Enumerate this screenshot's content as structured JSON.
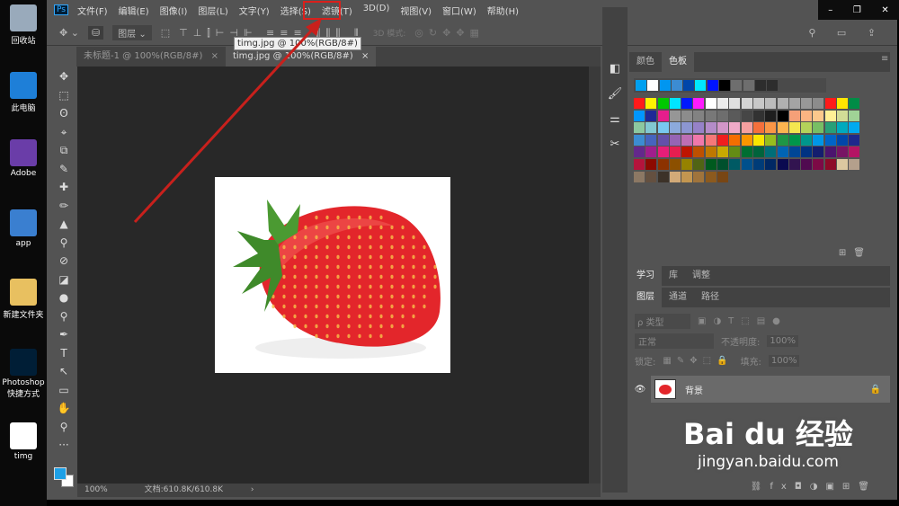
{
  "desktop": {
    "icons": [
      {
        "label": "回收站"
      },
      {
        "label": "此电脑"
      },
      {
        "label": "Adobe"
      },
      {
        "label": "app"
      },
      {
        "label": "新建文件夹"
      },
      {
        "label": "Photoshop 快捷方式"
      },
      {
        "label": "timg"
      }
    ]
  },
  "menu": {
    "logo": "Ps",
    "items": [
      "文件(F)",
      "编辑(E)",
      "图像(I)",
      "图层(L)",
      "文字(Y)",
      "选择(S)",
      "滤镜(T)",
      "3D(D)",
      "视图(V)",
      "窗口(W)",
      "帮助(H)"
    ],
    "highlighted": "滤镜(T)",
    "highlight_color": "#d9201c"
  },
  "options": {
    "auto_select": "图层",
    "mode_3d": "3D 模式:"
  },
  "tabs": [
    {
      "label": "未标题-1 @ 100%(RGB/8#)",
      "close": "×"
    },
    {
      "label": "timg.jpg @ 100%(RGB/8#)",
      "close": "×",
      "active": true
    }
  ],
  "tooltip": "timg.jpg @ 100%(RGB/8#)",
  "tools": [
    "✥",
    "⬚",
    "ʘ",
    "⌖",
    "⧉",
    "✎",
    "✚",
    "✏",
    "▲",
    "⚲",
    "⊘",
    "◪",
    "●",
    "⚲",
    "✒",
    "T",
    "↖",
    "▭",
    "✋",
    "⚲",
    "···"
  ],
  "colors": {
    "foreground": "#1ea0e6",
    "background": "#ffffff"
  },
  "status": {
    "zoom": "100%",
    "doc": "文档:610.8K/610.8K",
    "arrow": "›"
  },
  "color_panel": {
    "tabs": [
      "颜色",
      "色板"
    ],
    "active": "色板",
    "recent": [
      "#00a0f0",
      "#ffffff",
      "#0096f0",
      "#3c8cd2",
      "#0046aa",
      "#00e6ff",
      "#0014ff",
      "#000000",
      "#6e6e6e",
      "#6e6e6e",
      "#2d2d2d",
      "#2d2d2d"
    ],
    "swatches": [
      [
        "#ff1a1a",
        "#fff200",
        "#00c800",
        "#00e5ff",
        "#0018ff",
        "#ff1aff",
        "#ffffff",
        "#ececec",
        "#e0e0e0",
        "#d4d4d4",
        "#c8c8c8",
        "#bcbcbc",
        "#b0b0b0",
        "#a4a4a4",
        "#989898",
        "#8c8c8c",
        "#ff1a1a",
        "#ffe600",
        "#008c46"
      ],
      [
        "#0096ff",
        "#1e2896",
        "#e61e8c",
        "#969696",
        "#8c8c8c",
        "#828282",
        "#787878",
        "#6e6e6e",
        "#5a5a5a",
        "#464646",
        "#323232",
        "#1e1e1e",
        "#000000",
        "#f5a078",
        "#fab482",
        "#fcc88c",
        "#fff096",
        "#d2dc96",
        "#a0d296"
      ],
      [
        "#8cc8a0",
        "#82c8d2",
        "#78c8f0",
        "#8caadc",
        "#8c96d2",
        "#9682c8",
        "#b48cc8",
        "#d296c8",
        "#f0aac8",
        "#f5a0a0",
        "#f5703c",
        "#fa9646",
        "#fcb450",
        "#f5e650",
        "#b4d25a",
        "#78be64",
        "#28a078",
        "#00aabe",
        "#00aaf0"
      ],
      [
        "#3c8cd2",
        "#4664be",
        "#6450aa",
        "#9664b4",
        "#be6eb4",
        "#f078aa",
        "#f57878",
        "#f01e1e",
        "#f56e00",
        "#fa9600",
        "#fae600",
        "#96be1e",
        "#1e9646",
        "#00964b",
        "#00968c",
        "#0096e6",
        "#0064c8",
        "#0046aa",
        "#1e288c"
      ],
      [
        "#64288c",
        "#a01e8c",
        "#e61e78",
        "#e61e50",
        "#be1400",
        "#be5000",
        "#be7800",
        "#c8aa00",
        "#648c14",
        "#006e32",
        "#00643c",
        "#006e78",
        "#0064b4",
        "#004696",
        "#003282",
        "#141e6e",
        "#4b146e",
        "#781464",
        "#b41464"
      ],
      [
        "#b4143c",
        "#8c0a00",
        "#8c3200",
        "#8c5000",
        "#968200",
        "#506414",
        "#005a1e",
        "#00502d",
        "#005a64",
        "#00508c",
        "#003c78",
        "#002864",
        "#0a0a50",
        "#321450",
        "#500a50",
        "#7d0a46",
        "#8c0a28",
        "#dcc8a0",
        "#b4a08c"
      ],
      [
        "#8c7864",
        "#645040",
        "#3c3228",
        "#d2aa78",
        "#c39650",
        "#a0743c",
        "#8c5a1e",
        "#784614"
      ]
    ]
  },
  "learn_panel": {
    "tabs": [
      "学习",
      "库",
      "调整"
    ]
  },
  "layers_panel": {
    "tabs": [
      "图层",
      "通道",
      "路径"
    ],
    "filter": "ρ 类型",
    "blend": "正常",
    "opacity_label": "不透明度:",
    "opacity": "100%",
    "lock_label": "锁定:",
    "fill_label": "填充:",
    "fill": "100%",
    "layers": [
      {
        "name": "背景",
        "visible": true,
        "locked": true
      }
    ]
  },
  "watermark": {
    "brand": "Bai du 经验",
    "url": "jingyan.baidu.com"
  }
}
